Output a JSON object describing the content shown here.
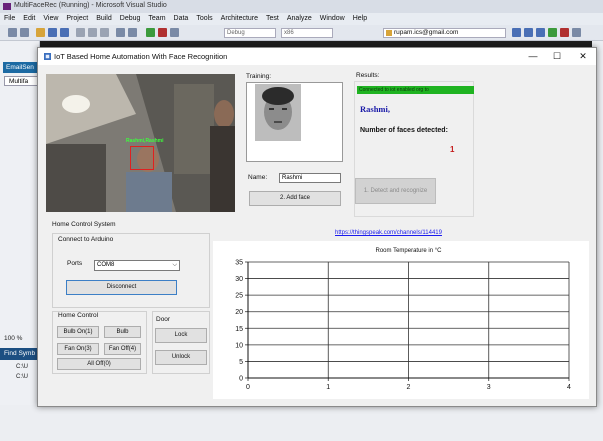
{
  "vs": {
    "title": "MultiFaceRec (Running) - Microsoft Visual Studio",
    "menu": [
      "File",
      "Edit",
      "View",
      "Project",
      "Build",
      "Debug",
      "Team",
      "Data",
      "Tools",
      "Architecture",
      "Test",
      "Analyze",
      "Window",
      "Help"
    ],
    "toolbar": {
      "config": "Debug",
      "platform": "x86",
      "account": "rupam.ics@gmail.com"
    },
    "left_tab": "EmailSen",
    "left_tab2": "Multifa",
    "zoom": "100 %",
    "find_panel": "Find Symb",
    "find_items": [
      "C:\\U",
      "C:\\U"
    ]
  },
  "window": {
    "title": "IoT Based Home Automation With Face Recognition",
    "controls": {
      "minimize": "—",
      "maximize": "☐",
      "close": "✕"
    }
  },
  "webcam": {
    "face_tag": "Rashmi,Rashmi"
  },
  "training": {
    "label": "Training:",
    "name_label": "Name:",
    "name_value": "Rashmi",
    "add_face_button": "2. Add face"
  },
  "results": {
    "label": "Results:",
    "status_bar": "Connected to iot enabled org to",
    "recognized_name": "Rashmi,",
    "faces_label": "Number of faces detected:",
    "faces_count": "1",
    "detect_button": "1. Detect and recognize"
  },
  "home_control_system": {
    "label": "Home Control System",
    "connect_group": "Connect to Arduino",
    "ports_label": "Ports",
    "port_value": "COM8",
    "disconnect_button": "Disconnect",
    "home_control_group": "Home Control",
    "buttons": {
      "bulb_on": "Bulb On(1)",
      "bulb": "Bulb",
      "fan_on": "Fan On(3)",
      "fan_off": "Fan Off(4)",
      "all_off": "All Off(0)"
    },
    "door_group": "Door",
    "lock_button": "Lock",
    "unlock_button": "Unlock"
  },
  "link": {
    "text": "https://thingspeak.com/channels/114419"
  },
  "chart_data": {
    "type": "line",
    "title": "Room Temperature in °C",
    "xlabel": "",
    "ylabel": "",
    "x_ticks": [
      0,
      1,
      2,
      3,
      4
    ],
    "y_ticks": [
      0,
      5,
      10,
      15,
      20,
      25,
      30,
      35
    ],
    "xlim": [
      0,
      4
    ],
    "ylim": [
      0,
      35
    ],
    "grid": true,
    "series": []
  }
}
